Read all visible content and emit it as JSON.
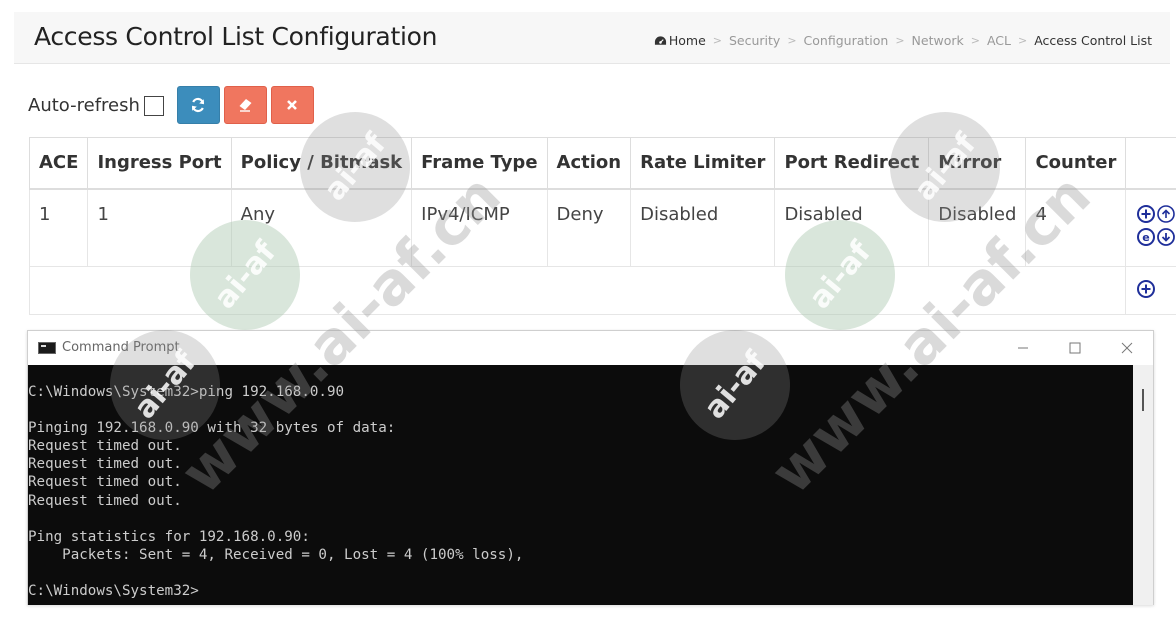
{
  "header": {
    "title": "Access Control List Configuration",
    "breadcrumb": [
      "Home",
      "Security",
      "Configuration",
      "Network",
      "ACL",
      "Access Control List"
    ],
    "breadcrumb_separator": ">"
  },
  "toolbar": {
    "auto_refresh_label": "Auto-refresh",
    "auto_refresh_checked": false
  },
  "table": {
    "columns": [
      "ACE",
      "Ingress Port",
      "Policy / Bitmask",
      "Frame Type",
      "Action",
      "Rate Limiter",
      "Port Redirect",
      "Mirror",
      "Counter",
      ""
    ],
    "rows": [
      {
        "ace": "1",
        "ingress_port": "1",
        "policy": "Any",
        "frame_type": "IPv4/ICMP",
        "action": "Deny",
        "rate_limiter": "Disabled",
        "port_redirect": "Disabled",
        "mirror": "Disabled",
        "counter": "4"
      }
    ]
  },
  "cmd": {
    "title": "Command Prompt",
    "lines": [
      "C:\\Windows\\System32>ping 192.168.0.90",
      "",
      "Pinging 192.168.0.90 with 32 bytes of data:",
      "Request timed out.",
      "Request timed out.",
      "Request timed out.",
      "Request timed out.",
      "",
      "Ping statistics for 192.168.0.90:",
      "    Packets: Sent = 4, Received = 0, Lost = 4 (100% loss),",
      "",
      "C:\\Windows\\System32>"
    ]
  },
  "watermark": {
    "text": "www.ai-af.cn",
    "badge": "ai-af"
  },
  "colors": {
    "refresh_button": "#3c8dbc",
    "clear_button": "#f0765f",
    "icon_blue": "#1f2f9a",
    "cmd_bg": "#0c0c0c",
    "cmd_text": "#cccccc"
  }
}
